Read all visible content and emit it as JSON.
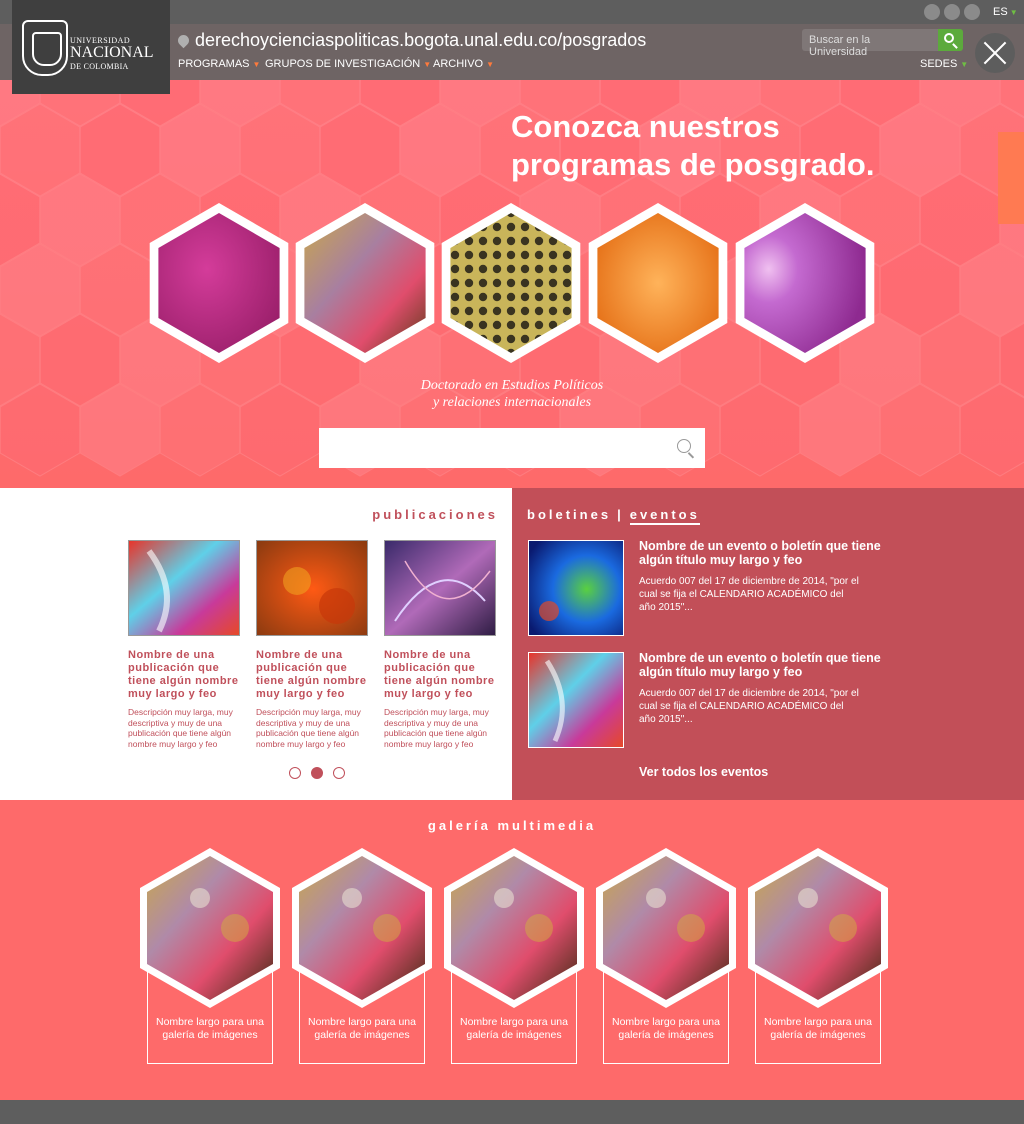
{
  "header": {
    "language": "ES",
    "logo": {
      "line1": "UNIVERSIDAD",
      "line2": "NACIONAL",
      "line3": "DE COLOMBIA"
    },
    "url": "derechoycienciaspoliticas.bogota.unal.edu.co/posgrados",
    "menu": [
      {
        "label": "PROGRAMAS"
      },
      {
        "label": "GRUPOS DE INVESTIGACIÓN"
      },
      {
        "label": "ARCHIVO"
      }
    ],
    "sedes_label": "SEDES",
    "search_placeholder": "Buscar en la Universidad"
  },
  "hero": {
    "title_line1": "Conozca nuestros",
    "title_line2": "programas de posgrado.",
    "caption_line1": "Doctorado en Estudios Políticos",
    "caption_line2": "y relaciones internacionales",
    "program_hexes": [
      "magenta",
      "oil-droplets",
      "gold-dots",
      "orange-bokeh",
      "violet-light"
    ]
  },
  "publications": {
    "heading": "publicaciones",
    "items": [
      {
        "title": "Nombre de una publicación que tiene algún nombre muy largo y feo",
        "description": "Descripción muy larga, muy descriptiva y muy de una publicación que tiene algún nombre muy largo y feo"
      },
      {
        "title": "Nombre de una publicación que tiene algún nombre muy largo y feo",
        "description": "Descripción muy larga, muy descriptiva y muy de una publicación que tiene algún nombre muy largo y feo"
      },
      {
        "title": "Nombre de una publicación que tiene algún nombre muy largo y feo",
        "description": "Descripción muy larga, muy descriptiva y muy de una publicación que tiene algún nombre muy largo y feo"
      }
    ],
    "carousel": {
      "pages": 3,
      "active_page": 2
    }
  },
  "events": {
    "tab_boletines": "boletines",
    "separator": "|",
    "tab_eventos": "eventos",
    "items": [
      {
        "title": "Nombre de un evento o boletín que tiene algún título muy largo y feo",
        "description": "Acuerdo 007 del 17 de diciembre de 2014, \"por el cual se fija el CALENDARIO ACADÉMICO del año 2015\"..."
      },
      {
        "title": "Nombre de un evento o boletín que tiene algún título muy largo y feo",
        "description": "Acuerdo 007 del 17 de diciembre de 2014, \"por el cual se fija el CALENDARIO ACADÉMICO del año 2015\"..."
      }
    ],
    "view_all": "Ver todos los eventos"
  },
  "gallery": {
    "heading": "galería multimedia",
    "items": [
      {
        "label": "Nombre largo para una galería de imágenes"
      },
      {
        "label": "Nombre largo para una galería de imágenes"
      },
      {
        "label": "Nombre largo para una galería de imágenes"
      },
      {
        "label": "Nombre largo para una galería de imágenes"
      },
      {
        "label": "Nombre largo para una galería de imágenes"
      }
    ]
  },
  "colors": {
    "page_background": "#fe6a6a",
    "top_bar": "#5e5e5e",
    "nav_bar": "#6e6464",
    "accent_text": "#c0505b",
    "events_panel": "#c24f58",
    "search_button": "#5caa3c",
    "menu_arrow": "#ff7a3c"
  }
}
